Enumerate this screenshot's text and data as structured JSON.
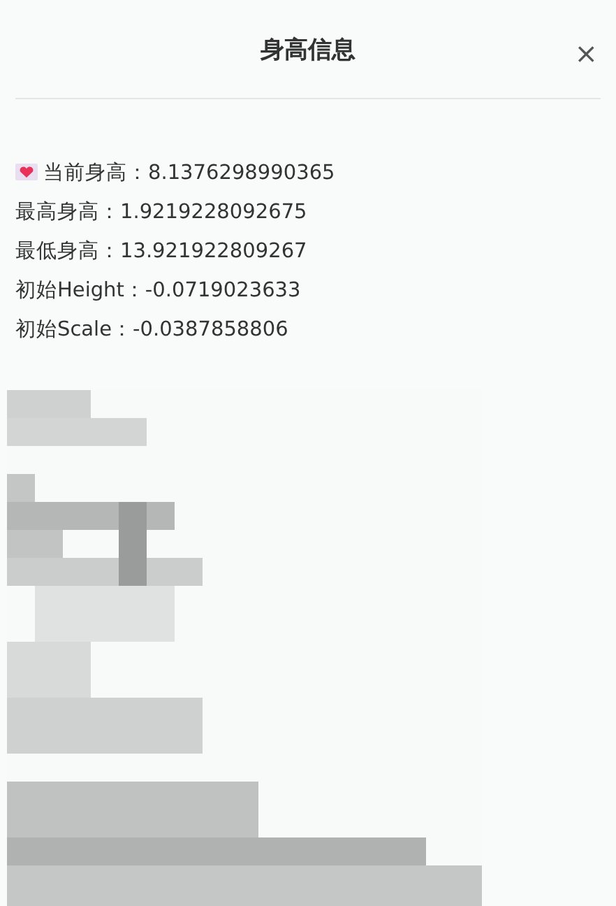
{
  "dialog": {
    "title": "身高信息",
    "close": "×"
  },
  "lines": [
    {
      "kind": "heart",
      "text": "当前身高：8.1376298990365"
    },
    {
      "kind": "plain",
      "text": "最高身高：1.9219228092675"
    },
    {
      "kind": "plain",
      "text": "最低身高：13.921922809267"
    },
    {
      "kind": "plain",
      "text": "初始Height：-0.0719023633"
    },
    {
      "kind": "plain",
      "text": "初始Scale：-0.0387858806"
    }
  ]
}
